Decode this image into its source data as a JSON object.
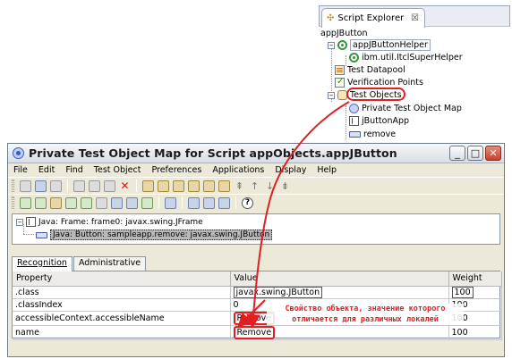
{
  "explorer": {
    "tab_title": "Script Explorer",
    "tab_close": "☒",
    "root": "appJButton",
    "items": [
      {
        "label": "appJButtonHelper",
        "icon": "green-circle-icon"
      },
      {
        "label": "ibm.util.ItclSuperHelper",
        "icon": "green-circle-icon"
      },
      {
        "label": "Test Datapool",
        "icon": "datapool-icon"
      },
      {
        "label": "Verification Points",
        "icon": "checkmark-icon"
      },
      {
        "label": "Test Objects",
        "icon": "objects-folder-icon"
      },
      {
        "label": "Private Test Object Map",
        "icon": "globe-icon"
      },
      {
        "label": "jButtonApp",
        "icon": "frame-icon"
      },
      {
        "label": "remove",
        "icon": "button-icon"
      }
    ]
  },
  "window": {
    "title": "Private Test Object Map for Script appObjects.appJButton",
    "controls": {
      "minimize": "_",
      "maximize": "□",
      "close": "✕"
    },
    "menu": [
      "File",
      "Edit",
      "Find",
      "Test Object",
      "Preferences",
      "Applications",
      "Display",
      "Help"
    ],
    "hierarchy": {
      "frame": "Java: Frame: frame0: javax.swing.JFrame",
      "button": "Java: Button: sampleapp.remove: javax.swing.JButton"
    },
    "tabs": [
      "Recognition",
      "Administrative"
    ],
    "table": {
      "headers": [
        "Property",
        "Value",
        "Weight"
      ],
      "rows": [
        {
          "property": ".class",
          "value": "javax.swing.JButton",
          "weight": "100"
        },
        {
          "property": ".classIndex",
          "value": "0",
          "weight": "100"
        },
        {
          "property": "accessibleContext.accessibleName",
          "value": "Remove",
          "weight": "100"
        },
        {
          "property": "name",
          "value": "Remove",
          "weight": "100"
        }
      ]
    }
  },
  "annotation": {
    "line1": "Свойство объекта, значение которого",
    "line2": "отличается для различных локалей",
    "color": "#e02020"
  }
}
